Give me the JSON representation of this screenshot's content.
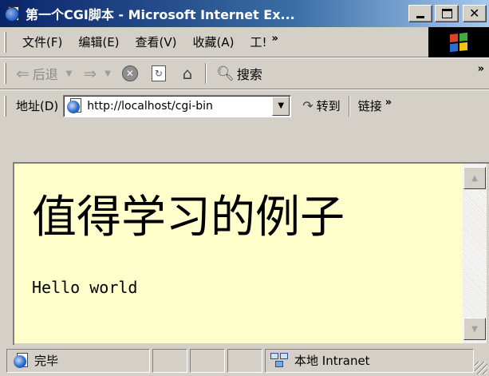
{
  "window": {
    "title": "第一个CGI脚本 - Microsoft Internet Ex...",
    "min_glyph": "",
    "max_glyph": "",
    "close_glyph": "✕"
  },
  "menubar": {
    "items": [
      "文件(F)",
      "编辑(E)",
      "查看(V)",
      "收藏(A)",
      "工!"
    ],
    "more": "»"
  },
  "toolbar": {
    "back": "后退",
    "search": "搜索",
    "more": "»"
  },
  "addressbar": {
    "label": "地址(D)",
    "url": "http://localhost/cgi-bin",
    "go": "转到",
    "links": "链接",
    "more": "»"
  },
  "page": {
    "heading": "值得学习的例子",
    "body": "Hello world",
    "background": "#ffffcc"
  },
  "statusbar": {
    "status": "完毕",
    "zone": "本地 Intranet"
  },
  "colors": {
    "titlebar_start": "#0a246a",
    "titlebar_end": "#a6caf0",
    "chrome": "#d4d0c8"
  },
  "icons": {
    "app": "ie-page-icon",
    "back": "back-arrow-icon",
    "forward": "forward-arrow-icon",
    "stop": "stop-icon",
    "refresh": "refresh-icon",
    "home": "home-icon",
    "search": "search-magnifier-icon",
    "go": "go-arrow-icon",
    "zone": "local-intranet-icon"
  }
}
